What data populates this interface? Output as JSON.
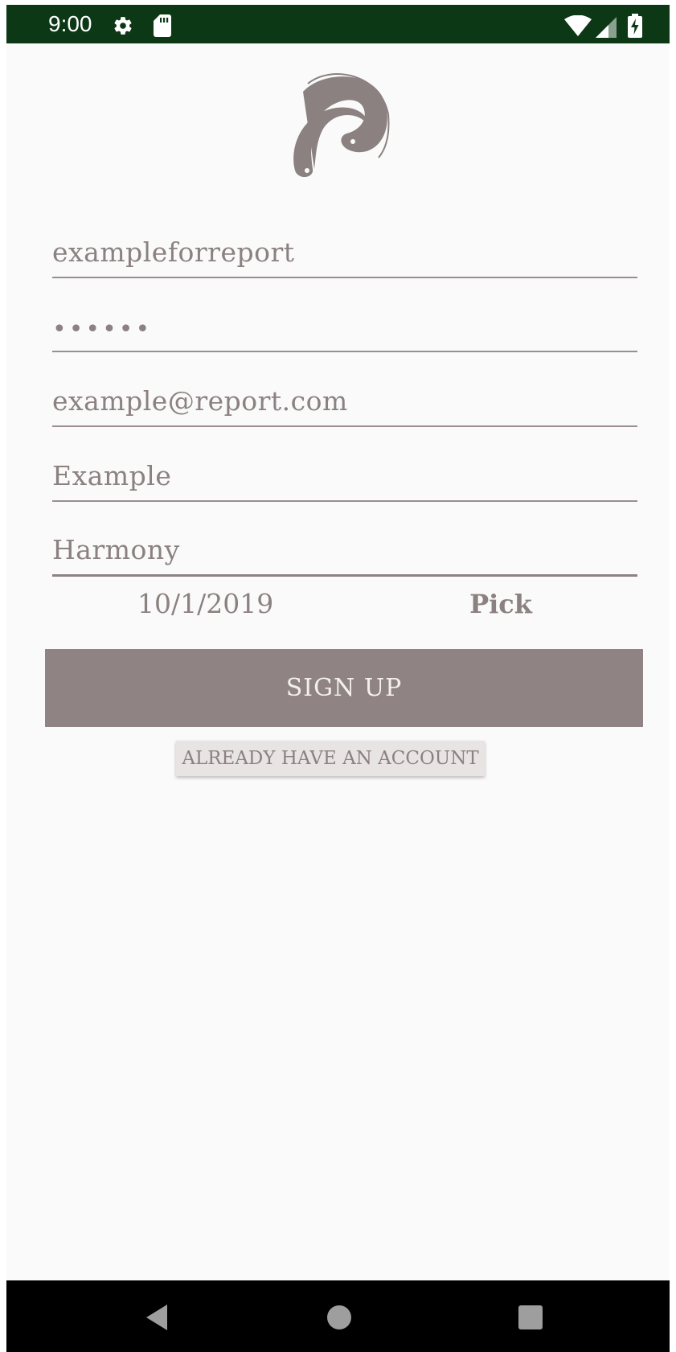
{
  "status_bar": {
    "time": "9:00",
    "icons": [
      "gear-icon",
      "sd-card-icon",
      "wifi-icon",
      "signal-icon",
      "battery-charging-icon"
    ],
    "background_color": "#0d3816"
  },
  "logo": {
    "icon": "harmony-swirl-logo",
    "color": "#8c8181"
  },
  "form": {
    "username": "exampleforreport",
    "password_mask": "••••••",
    "email": "example@report.com",
    "first_name": "Example",
    "last_name": "Harmony",
    "date": "10/1/2019",
    "pick_label": "Pick",
    "signup_label": "SIGN UP",
    "already_label": "ALREADY HAVE AN ACCOUNT"
  },
  "nav_bar": {
    "icons": [
      "back-icon",
      "home-icon",
      "recents-icon"
    ]
  },
  "colors": {
    "text": "#8c8181",
    "button": "#8f8483",
    "underline": "#9b8e8e",
    "background": "#fafafa"
  }
}
